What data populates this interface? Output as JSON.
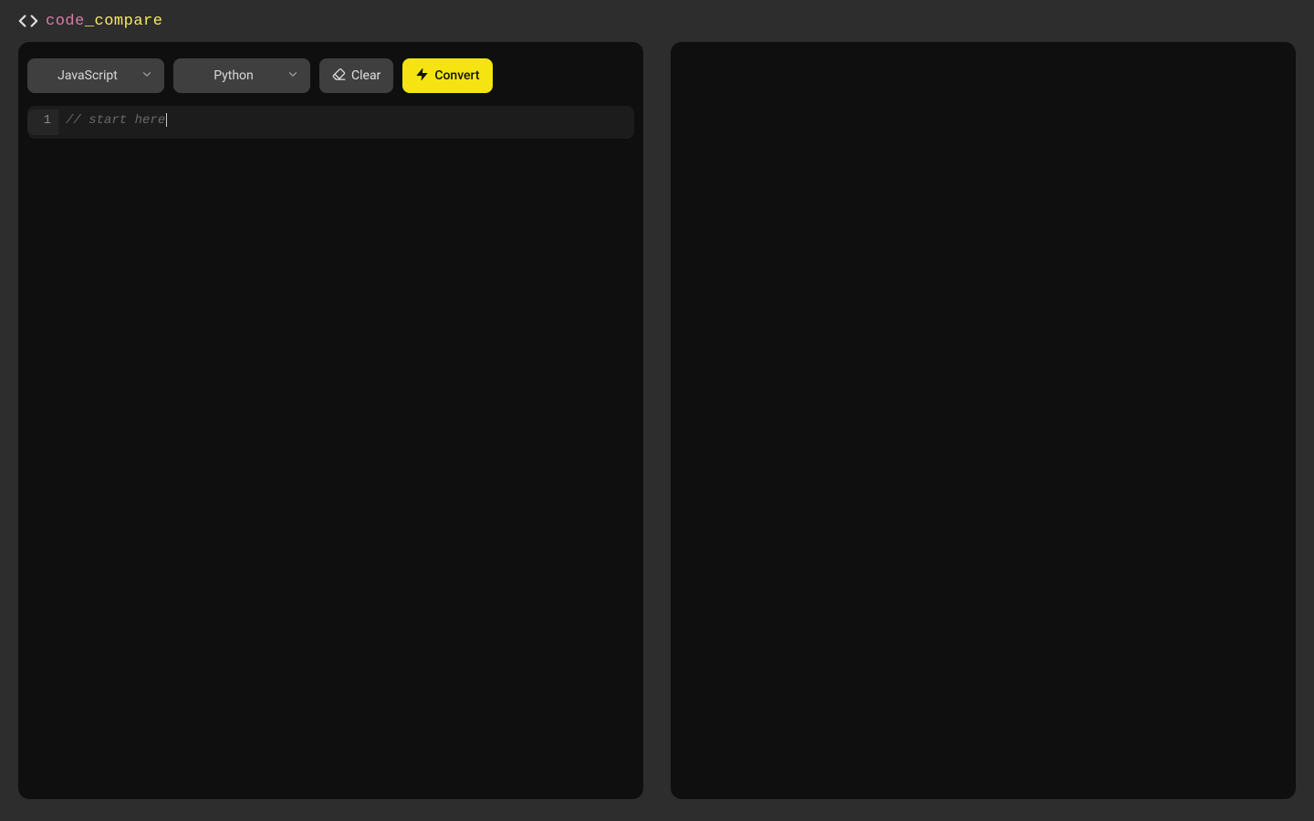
{
  "brand": {
    "part1": "code",
    "underscore": "_",
    "part2": "compare"
  },
  "toolbar": {
    "source_lang": "JavaScript",
    "target_lang": "Python",
    "clear_label": "Clear",
    "convert_label": "Convert"
  },
  "editor": {
    "line_number": "1",
    "placeholder": "// start here"
  },
  "colors": {
    "accent_yellow": "#f5e411",
    "brand_pink": "#d87ca8",
    "bg_page": "#2d2d2d",
    "bg_panel": "#0f0f0f",
    "bg_control": "#3f3f3f",
    "bg_editor": "#1c1c1c"
  }
}
